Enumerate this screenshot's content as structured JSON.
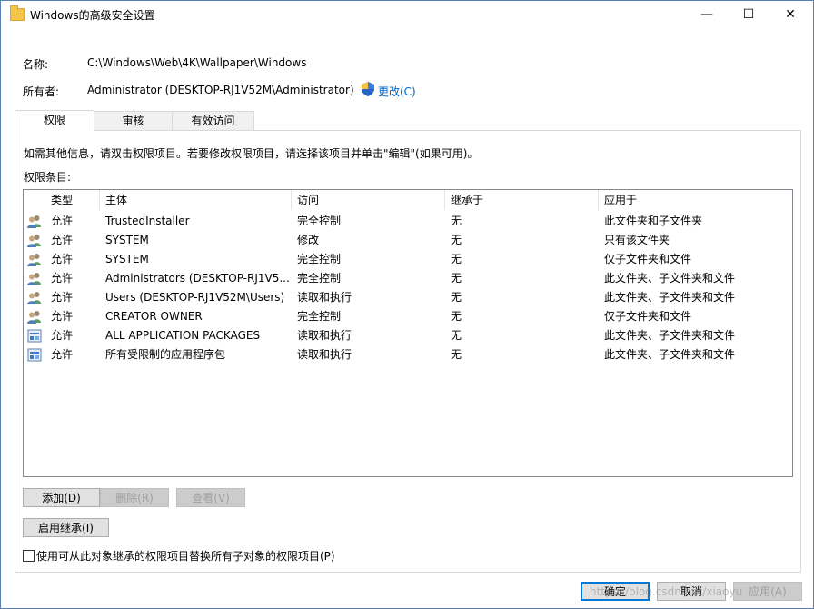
{
  "window": {
    "title": "Windows的高级安全设置",
    "minimize": "—",
    "maximize": "☐",
    "close": "✕"
  },
  "info": {
    "name_label": "名称:",
    "name_value": "C:\\Windows\\Web\\4K\\Wallpaper\\Windows",
    "owner_label": "所有者:",
    "owner_value": "Administrator (DESKTOP-RJ1V52M\\Administrator)",
    "change_link": "更改(C)"
  },
  "tabs": [
    {
      "label": "权限"
    },
    {
      "label": "审核"
    },
    {
      "label": "有效访问"
    }
  ],
  "hint": "如需其他信息，请双击权限项目。若要修改权限项目，请选择该项目并单击\"编辑\"(如果可用)。",
  "entries_label": "权限条目:",
  "table": {
    "headers": [
      "类型",
      "主体",
      "访问",
      "继承于",
      "应用于"
    ],
    "rows": [
      {
        "icon": "user-group-icon",
        "type": "允许",
        "principal": "TrustedInstaller",
        "access": "完全控制",
        "inherited": "无",
        "applies": "此文件夹和子文件夹"
      },
      {
        "icon": "user-group-icon",
        "type": "允许",
        "principal": "SYSTEM",
        "access": "修改",
        "inherited": "无",
        "applies": "只有该文件夹"
      },
      {
        "icon": "user-group-icon",
        "type": "允许",
        "principal": "SYSTEM",
        "access": "完全控制",
        "inherited": "无",
        "applies": "仅子文件夹和文件"
      },
      {
        "icon": "user-group-icon",
        "type": "允许",
        "principal": "Administrators (DESKTOP-RJ1V5...",
        "access": "完全控制",
        "inherited": "无",
        "applies": "此文件夹、子文件夹和文件"
      },
      {
        "icon": "user-group-icon",
        "type": "允许",
        "principal": "Users (DESKTOP-RJ1V52M\\Users)",
        "access": "读取和执行",
        "inherited": "无",
        "applies": "此文件夹、子文件夹和文件"
      },
      {
        "icon": "user-group-icon",
        "type": "允许",
        "principal": "CREATOR OWNER",
        "access": "完全控制",
        "inherited": "无",
        "applies": "仅子文件夹和文件"
      },
      {
        "icon": "app-package-icon",
        "type": "允许",
        "principal": "ALL APPLICATION PACKAGES",
        "access": "读取和执行",
        "inherited": "无",
        "applies": "此文件夹、子文件夹和文件"
      },
      {
        "icon": "app-package-icon",
        "type": "允许",
        "principal": "所有受限制的应用程序包",
        "access": "读取和执行",
        "inherited": "无",
        "applies": "此文件夹、子文件夹和文件"
      }
    ]
  },
  "buttons": {
    "add": "添加(D)",
    "remove": "删除(R)",
    "view": "查看(V)",
    "enable_inheritance": "启用继承(I)",
    "ok": "确定",
    "cancel": "取消",
    "apply": "应用(A)"
  },
  "replace_checkbox": {
    "label": "使用可从此对象继承的权限项目替换所有子对象的权限项目(P)",
    "checked": false
  },
  "watermark": "https://blog.csdn.net/xiaoyu"
}
